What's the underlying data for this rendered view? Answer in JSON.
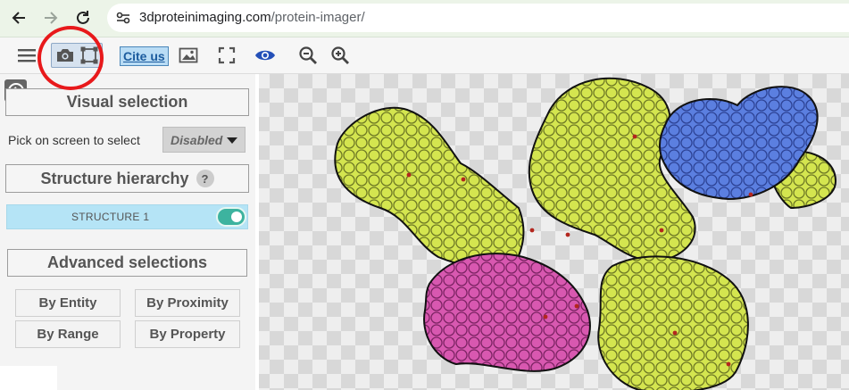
{
  "browser": {
    "url_host": "3dproteinimaging.com",
    "url_path": "/protein-imager/",
    "icons": [
      "back-arrow-icon",
      "forward-arrow-icon",
      "reload-icon",
      "site-info-icon"
    ]
  },
  "toolbar": {
    "cite_label": "Cite us",
    "icons": [
      "menu-icon",
      "camera-icon",
      "crop-selection-icon",
      "image-icon",
      "fullscreen-icon",
      "eye-icon",
      "zoom-out-icon",
      "zoom-in-icon"
    ]
  },
  "panel": {
    "visual_selection_title": "Visual selection",
    "pick_label": "Pick on screen to select",
    "pick_value": "Disabled",
    "hierarchy_title": "Structure hierarchy",
    "help_glyph": "?",
    "structure_label": "STRUCTURE 1",
    "structure_enabled": true,
    "advanced_title": "Advanced selections",
    "buttons": {
      "by_entity": "By Entity",
      "by_proximity": "By Proximity",
      "by_range": "By Range",
      "by_property": "By Property"
    }
  },
  "colors": {
    "chain_yellow": "#d4e54f",
    "chain_blue": "#5b7fe0",
    "chain_pink": "#d858b0",
    "annotation_red": "#e8191b",
    "toggle_on": "#3db39f"
  }
}
